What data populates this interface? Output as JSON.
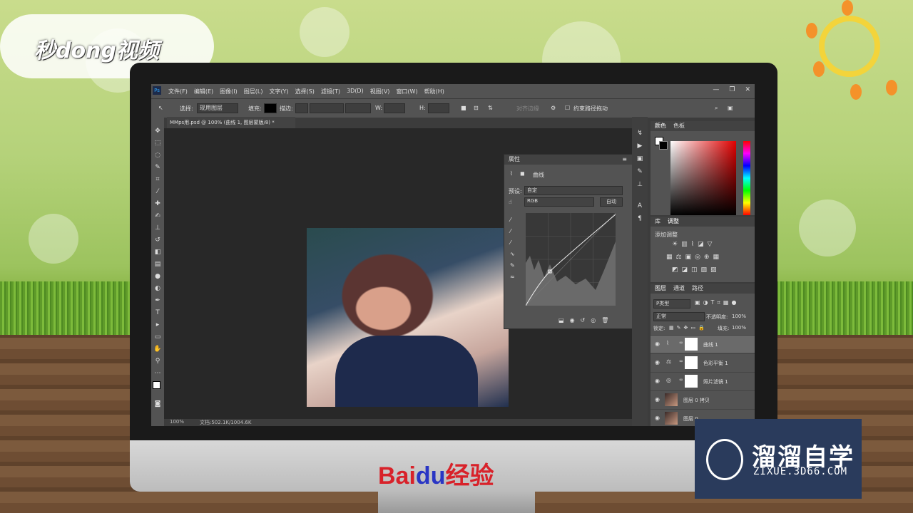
{
  "branding": {
    "top_left_logo": "秒dong视频",
    "monitor_logo_bai": "Bai",
    "monitor_logo_du": "du",
    "monitor_logo_suffix": "经验",
    "watermark_title": "溜溜自学",
    "watermark_url": "ZIXUE.3D66.COM"
  },
  "menubar": {
    "app_icon": "Ps",
    "items": [
      "文件(F)",
      "编辑(E)",
      "图像(I)",
      "图层(L)",
      "文字(Y)",
      "选择(S)",
      "滤镜(T)",
      "3D(D)",
      "视图(V)",
      "窗口(W)",
      "帮助(H)"
    ],
    "window_controls": [
      "—",
      "❐",
      "✕"
    ]
  },
  "options_bar": {
    "select_label": "选择:",
    "select_value": "现用图层",
    "fill_label": "填充:",
    "stroke_label": "描边:",
    "w_label": "W:",
    "h_label": "H:",
    "align_edges": "对齐边缘",
    "constrain_paths": "约束路径拖动"
  },
  "document": {
    "tab_title": "MMps用.psd @ 100% (曲线 1, 图层蒙版/8) *",
    "zoom": "100%",
    "doc_size": "文档:502.1K/1004.6K"
  },
  "properties_panel": {
    "title": "属性",
    "adjustment_name": "曲线",
    "preset_label": "预设:",
    "preset_value": "自定",
    "channel_value": "RGB",
    "auto_button": "自动"
  },
  "color_panel": {
    "tabs": [
      "颜色",
      "色板"
    ],
    "foreground": "#ffffff",
    "background": "#000000",
    "field_hue": "#e00000"
  },
  "adjustments_panel": {
    "tabs": [
      "库",
      "调整"
    ],
    "add_label": "添加调整"
  },
  "layers_panel": {
    "tabs": [
      "图层",
      "通道",
      "路径"
    ],
    "kind_filter": "P类型",
    "blend_mode": "正常",
    "opacity_label": "不透明度:",
    "opacity_value": "100%",
    "lock_label": "锁定:",
    "fill_label": "填充:",
    "fill_value": "100%",
    "layers": [
      {
        "name": "曲线 1",
        "selected": true
      },
      {
        "name": "色彩平衡 1",
        "selected": false
      },
      {
        "name": "照片滤镜 1",
        "selected": false
      },
      {
        "name": "图层 0 拷贝",
        "selected": false
      },
      {
        "name": "图层 0",
        "selected": false
      }
    ]
  },
  "icons": {
    "eye": "eye-icon",
    "link": "link-icon",
    "search": "search-icon",
    "gear": "gear-icon"
  }
}
